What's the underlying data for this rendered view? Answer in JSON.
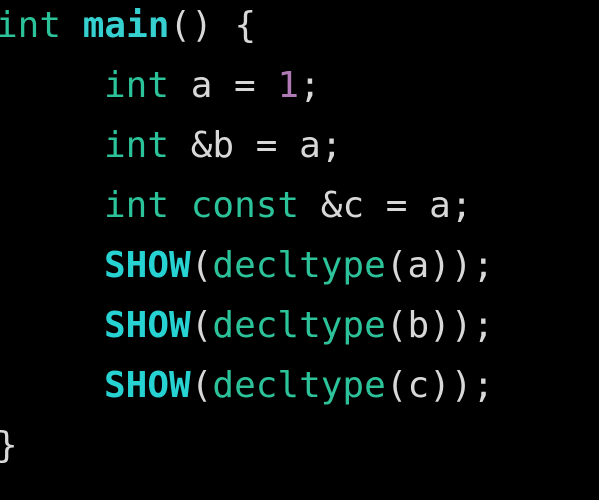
{
  "editor": {
    "lines": [
      {
        "t1": "int",
        "t2": " ",
        "t3": "main",
        "t4": "() {"
      },
      {
        "t1": "int",
        "t2": " a = ",
        "t3": "1",
        "t4": ";"
      },
      {
        "t1": "int",
        "t2": " &b = a;"
      },
      {
        "t1": "int",
        "t2": " ",
        "t3": "const",
        "t4": " &c = a;"
      },
      {
        "t1": "SHOW",
        "t2": "(",
        "t3": "decltype",
        "t4": "(a));"
      },
      {
        "t1": "SHOW",
        "t2": "(",
        "t3": "decltype",
        "t4": "(b));"
      },
      {
        "t1": "SHOW",
        "t2": "(",
        "t3": "decltype",
        "t4": "(c));"
      },
      {
        "t1": "}"
      }
    ]
  },
  "colors": {
    "background": "#000000",
    "keyword": "#2cc39a",
    "function_name": "#35d0cf",
    "macro": "#27d3d2",
    "number_literal": "#b07ab6",
    "plain_text": "#d8d8d8"
  }
}
